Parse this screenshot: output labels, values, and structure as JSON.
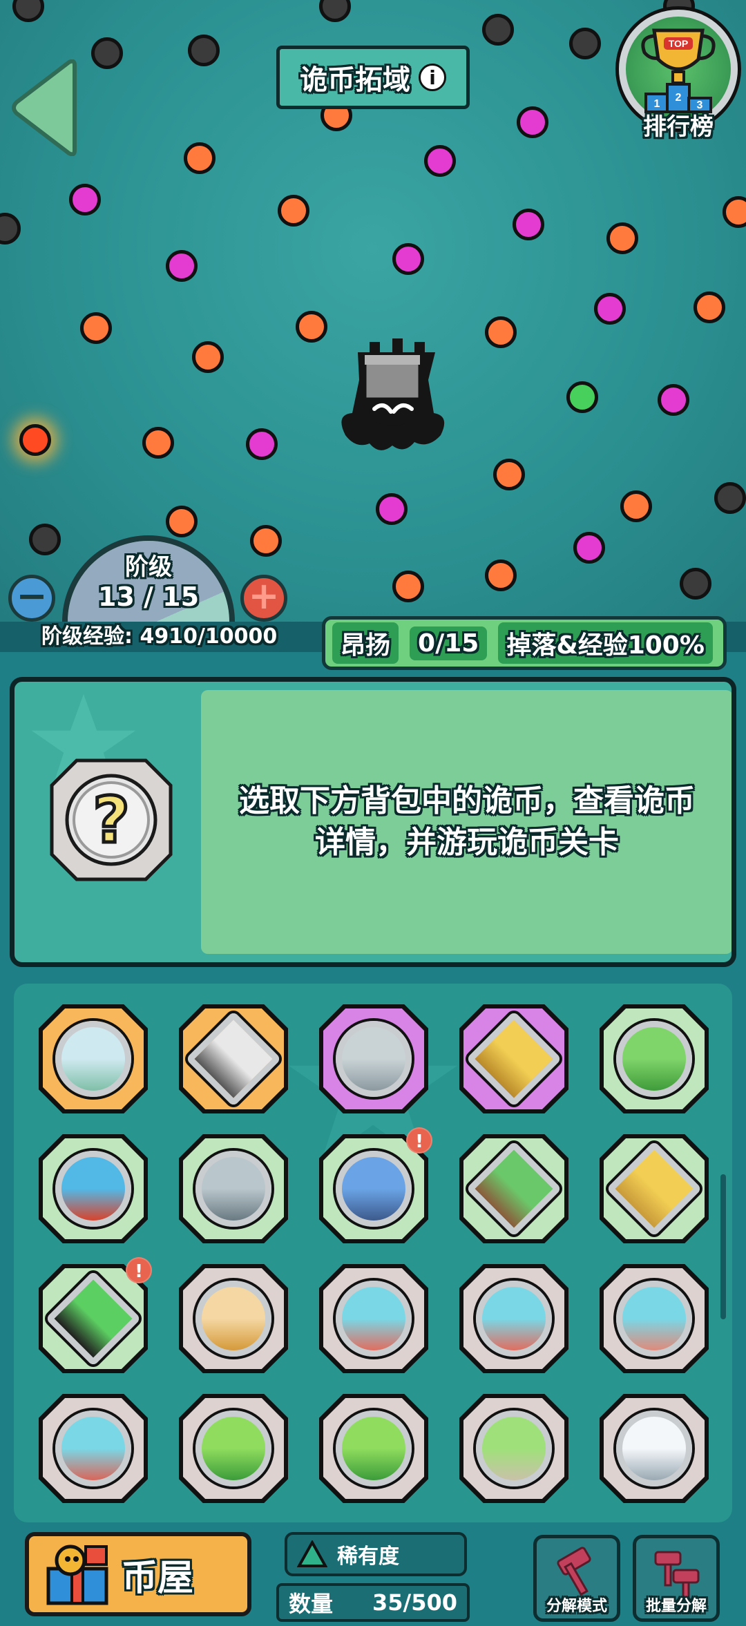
{
  "header": {
    "title": "诡币拓域",
    "info_icon": "i",
    "ranking_label": "排行榜",
    "ranking_badge": "TOP",
    "podium": [
      "1",
      "2",
      "3"
    ]
  },
  "level": {
    "label": "阶级",
    "value": "13 / 15",
    "progress": 0.867,
    "minus": "−",
    "plus": "+"
  },
  "exp": {
    "label": "阶级经验:",
    "value": "4910/10000"
  },
  "buff": {
    "name": "昂扬",
    "count": "0/15",
    "bonus": "掉落&经验100%"
  },
  "info_card": {
    "placeholder_icon": "?",
    "description": "选取下方背包中的诡币，查看诡币详情，并游玩诡币关卡"
  },
  "inventory": {
    "tiles": [
      {
        "rarity": "orange",
        "icon": "snow-mountain-coin-icon",
        "shape": "circle",
        "badge": ""
      },
      {
        "rarity": "orange",
        "icon": "chess-floor-coin-icon",
        "shape": "diamond",
        "badge": ""
      },
      {
        "rarity": "purple",
        "icon": "skull-ruins-coin-icon",
        "shape": "circle",
        "badge": ""
      },
      {
        "rarity": "purple",
        "icon": "golden-temple-coin-icon",
        "shape": "diamond",
        "badge": ""
      },
      {
        "rarity": "green",
        "icon": "green-hills-coin-icon",
        "shape": "circle",
        "badge": ""
      },
      {
        "rarity": "green",
        "icon": "volcano-coin-icon",
        "shape": "circle",
        "badge": ""
      },
      {
        "rarity": "green",
        "icon": "stone-fortress-coin-icon",
        "shape": "circle",
        "badge": ""
      },
      {
        "rarity": "green",
        "icon": "blue-tower-coin-icon",
        "shape": "circle",
        "badge": "!"
      },
      {
        "rarity": "green",
        "icon": "farm-field-coin-icon",
        "shape": "diamond",
        "badge": ""
      },
      {
        "rarity": "green",
        "icon": "temple-gate-coin-icon",
        "shape": "diamond",
        "badge": ""
      },
      {
        "rarity": "green",
        "icon": "pylon-field-coin-icon",
        "shape": "diamond",
        "badge": "!"
      },
      {
        "rarity": "gray",
        "icon": "sphinx-coin-icon",
        "shape": "circle",
        "badge": ""
      },
      {
        "rarity": "gray",
        "icon": "red-castle-coin-icon",
        "shape": "circle",
        "badge": ""
      },
      {
        "rarity": "gray",
        "icon": "red-castle-coin-icon",
        "shape": "circle",
        "badge": ""
      },
      {
        "rarity": "gray",
        "icon": "ruined-wall-coin-icon",
        "shape": "circle",
        "badge": ""
      },
      {
        "rarity": "gray",
        "icon": "red-wall-coin-icon",
        "shape": "circle",
        "badge": ""
      },
      {
        "rarity": "gray",
        "icon": "meadow-coin-icon",
        "shape": "circle",
        "badge": ""
      },
      {
        "rarity": "gray",
        "icon": "meadow-coin-icon",
        "shape": "circle",
        "badge": ""
      },
      {
        "rarity": "gray",
        "icon": "hill-tower-coin-icon",
        "shape": "circle",
        "badge": ""
      },
      {
        "rarity": "gray",
        "icon": "snow-tower-coin-icon",
        "shape": "circle",
        "badge": ""
      }
    ]
  },
  "bottom": {
    "coin_house": "币屋",
    "rarity": "稀有度",
    "count_label": "数量",
    "count_value": "35/500",
    "split_mode": "分解模式",
    "batch_split": "批量分解"
  },
  "colors": {
    "orange_peg": "#ff7a3c",
    "magenta_peg": "#e43bd0",
    "dark_peg": "#3b3b3b",
    "green_peg": "#48d05c",
    "rarity_orange": "#f7b75a",
    "rarity_purple": "#d884e6",
    "rarity_green": "#bfe6bd",
    "rarity_gray": "#ddd2d0"
  }
}
